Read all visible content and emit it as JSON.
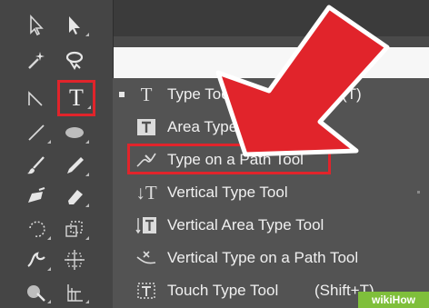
{
  "toolbar": {
    "tools": [
      {
        "name": "selection-tool",
        "icon": "selection-arrow-icon"
      },
      {
        "name": "direct-selection-tool",
        "icon": "direct-selection-arrow-icon"
      },
      {
        "name": "magic-wand-tool",
        "icon": "magic-wand-icon"
      },
      {
        "name": "lasso-tool",
        "icon": "lasso-icon"
      },
      {
        "name": "pen-tool",
        "icon": "pen-icon"
      },
      {
        "name": "type-tool",
        "icon": "type-icon",
        "glyph": "T"
      },
      {
        "name": "line-segment-tool",
        "icon": "line-icon"
      },
      {
        "name": "ellipse-tool",
        "icon": "ellipse-icon"
      },
      {
        "name": "paintbrush-tool",
        "icon": "paintbrush-icon"
      },
      {
        "name": "pencil-tool",
        "icon": "pencil-icon"
      },
      {
        "name": "blob-brush-tool",
        "icon": "blob-brush-icon"
      },
      {
        "name": "eraser-tool",
        "icon": "eraser-icon"
      },
      {
        "name": "rotate-tool",
        "icon": "rotate-icon"
      },
      {
        "name": "scale-tool",
        "icon": "scale-icon"
      },
      {
        "name": "width-tool",
        "icon": "width-icon"
      },
      {
        "name": "free-transform-tool",
        "icon": "free-transform-icon"
      },
      {
        "name": "shape-builder-tool",
        "icon": "shape-builder-icon"
      },
      {
        "name": "perspective-grid-tool",
        "icon": "perspective-grid-icon"
      }
    ]
  },
  "menu": {
    "items": [
      {
        "label": "Type Tool",
        "shortcut": "(T)",
        "icon": "type-icon",
        "glyph": "T",
        "active": true
      },
      {
        "label": "Area Type Tool",
        "shortcut": "",
        "icon": "area-type-icon",
        "glyph": "T"
      },
      {
        "label": "Type on a Path Tool",
        "shortcut": "",
        "icon": "type-on-path-icon",
        "glyph": ""
      },
      {
        "label": "Vertical Type Tool",
        "shortcut": "",
        "icon": "vertical-type-icon",
        "glyph": "↓T"
      },
      {
        "label": "Vertical Area Type Tool",
        "shortcut": "",
        "icon": "vertical-area-type-icon",
        "glyph": "↓T"
      },
      {
        "label": "Vertical Type on a Path Tool",
        "shortcut": "",
        "icon": "vertical-type-on-path-icon",
        "glyph": ""
      },
      {
        "label": "Touch Type Tool",
        "shortcut": "(Shift+T)",
        "icon": "touch-type-icon",
        "glyph": "T"
      }
    ]
  },
  "watermark": {
    "text": "wikiHow"
  },
  "colors": {
    "highlight": "#e1242b",
    "arrow": "#e1242b",
    "panel": "#535353",
    "toolbar": "#454545"
  }
}
